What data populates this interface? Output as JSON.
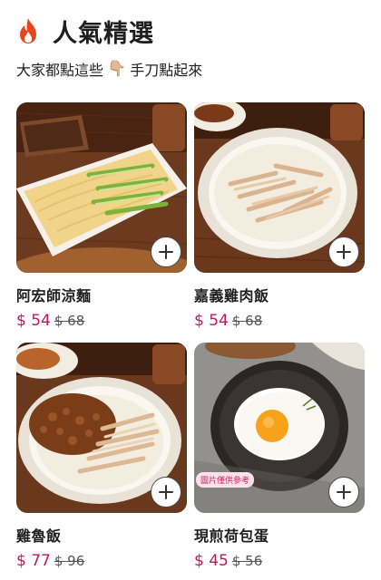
{
  "header": {
    "title": "人氣精選",
    "icon": "flame-icon"
  },
  "subtitle": {
    "text_before": "大家都點這些",
    "hand_emoji": "👇🏼",
    "text_after": "手刀點起來"
  },
  "products": [
    {
      "name": "阿宏師涼麵",
      "price": "$ 54",
      "original_price": "$ 68"
    },
    {
      "name": "嘉義雞肉飯",
      "price": "$ 54",
      "original_price": "$ 68"
    },
    {
      "name": "雞魯飯",
      "price": "$ 77",
      "original_price": "$ 96"
    },
    {
      "name": "現煎荷包蛋",
      "price": "$ 45",
      "original_price": "$ 56",
      "tag": "圖片僅供參考"
    }
  ],
  "colors": {
    "accent": "#c2185b",
    "flame": "#e8451e",
    "tag_bg": "#fde1ea"
  }
}
